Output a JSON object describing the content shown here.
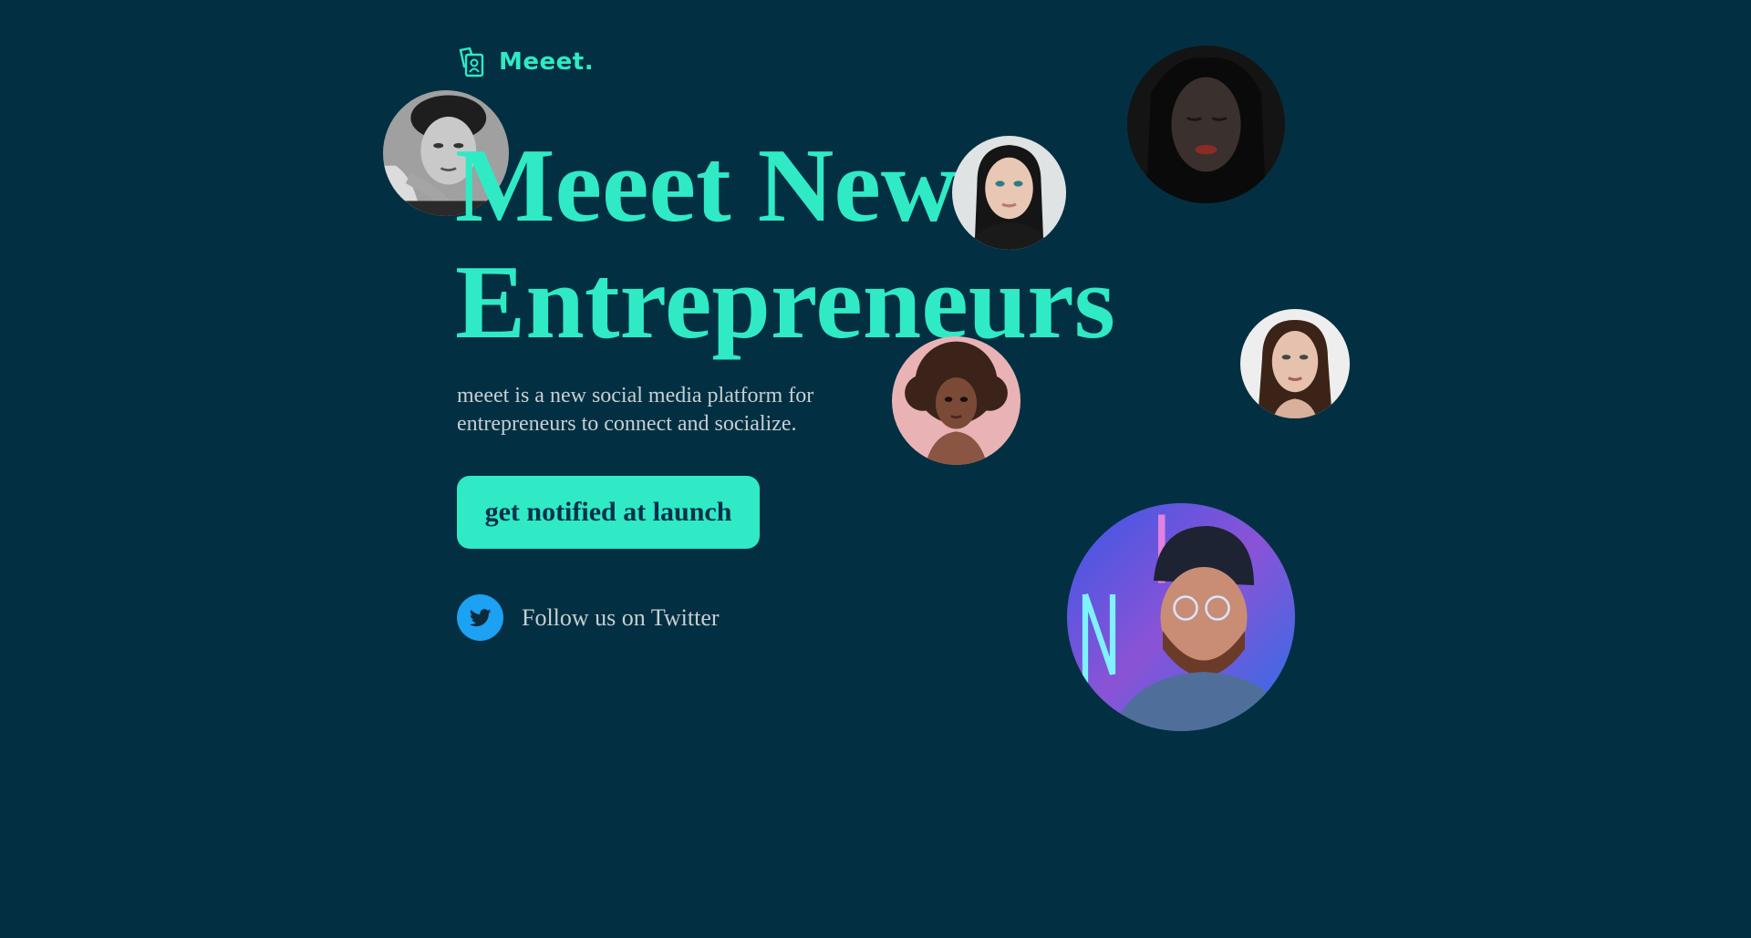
{
  "brand": {
    "name": "Meeet.",
    "logo_icon": "photo-cards-icon",
    "accent_color": "#2FEAC5",
    "background_color": "#023042"
  },
  "hero": {
    "headline_line1": "Meeet New",
    "headline_line2": "Entrepreneurs",
    "subtext": "meeet is a new social media platform for entrepreneurs to connect and socialize.",
    "cta_label": "get notified at launch"
  },
  "social": {
    "twitter_label": "Follow us on Twitter",
    "twitter_icon": "twitter-bird-icon",
    "twitter_color": "#1DA1F2"
  },
  "avatars": [
    {
      "name": "avatar-man-bw",
      "description": "portrait"
    },
    {
      "name": "avatar-woman-dark-hair",
      "description": "portrait"
    },
    {
      "name": "avatar-woman-closed-eyes",
      "description": "portrait"
    },
    {
      "name": "avatar-woman-auburn",
      "description": "portrait"
    },
    {
      "name": "avatar-woman-curly",
      "description": "portrait"
    },
    {
      "name": "avatar-man-beanie",
      "description": "portrait"
    }
  ]
}
